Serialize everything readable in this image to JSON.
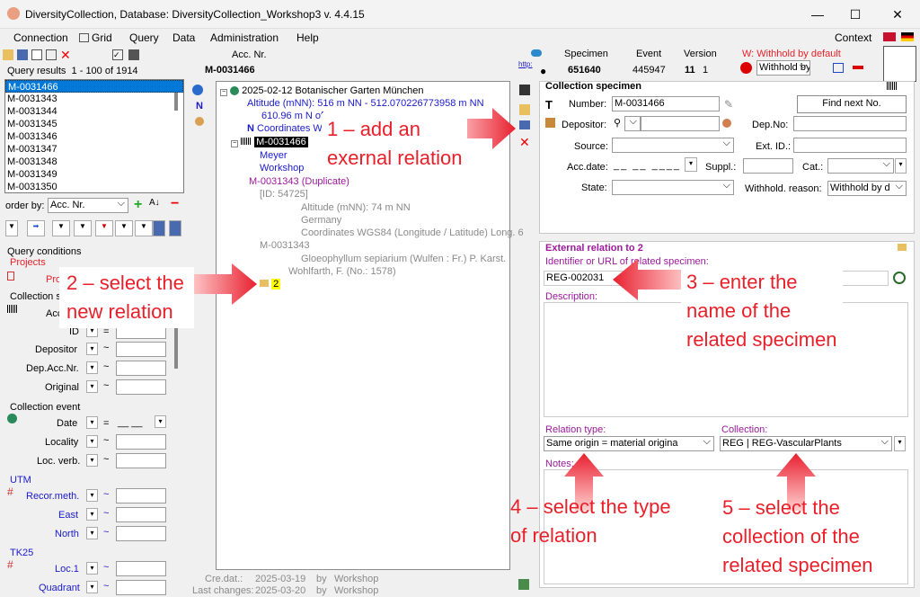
{
  "window": {
    "title": "DiversityCollection,  Database: DiversityCollection_Workshop3    v. 4.4.15"
  },
  "menu": {
    "connection": "Connection",
    "grid": "Grid",
    "query": "Query",
    "data": "Data",
    "administration": "Administration",
    "help": "Help",
    "context": "Context"
  },
  "query_results": {
    "label": "Query results",
    "range": "1 - 100 of 1914",
    "items": [
      "M-0031466",
      "M-0031343",
      "M-0031344",
      "M-0031345",
      "M-0031346",
      "M-0031347",
      "M-0031348",
      "M-0031349",
      "M-0031350"
    ]
  },
  "order_by": {
    "label": "order by:",
    "value": "Acc. Nr."
  },
  "query_conditions": {
    "label": "Query conditions",
    "projects": "Projects",
    "pro": "Pro",
    "collection_s": "Collection s",
    "acc": "Acc",
    "fields": [
      "ID",
      "Depositor",
      "Dep.Acc.Nr.",
      "Original"
    ],
    "collection_event": "Collection event",
    "event_fields": [
      "Date",
      "Locality",
      "Loc. verb."
    ],
    "utm": "UTM",
    "utm_fields": [
      "Recor.meth.",
      "East",
      "North"
    ],
    "tk25": "TK25",
    "tk25_fields": [
      "Loc.1",
      "Quadrant"
    ],
    "eq": "=",
    "tilde": "~",
    "date_blank": "__ __"
  },
  "header": {
    "acc_nr_label": "Acc. Nr.",
    "acc_nr": "M-0031466",
    "specimen_label": "Specimen",
    "specimen": "651640",
    "event_label": "Event",
    "event": "445947",
    "version_label": "Version",
    "version_a": "11",
    "version_b": "1",
    "withhold_label": "W: Withhold by default",
    "withhold_value": "Withhold by",
    "http": "http:"
  },
  "tree": {
    "event": "2025-02-12 Botanischer Garten München",
    "altitude": "Altitude (mNN): 516 m NN - 512.070226773958 m NN",
    "alt2": "610.96 m N of",
    "coords": "Coordinates W",
    "specimen": "M-0031466",
    "meyer": "Meyer",
    "workshop": "Workshop",
    "dup": "M-0031343 (Duplicate)",
    "id": "[ID: 54725]",
    "dup_alt": "Altitude (mNN): 74 m NN",
    "dup_country": "Germany",
    "dup_coords": "Coordinates WGS84 (Longitude / Latitude) Long. 6",
    "dup_spec": "M-0031343",
    "dup_taxon": "Gloeophyllum sepiarium (Wulfen : Fr.) P. Karst.",
    "wohlfarth": "Wohlfarth, F. (No.: 1578)",
    "new_rel": "2"
  },
  "footer": {
    "created_label": "Cre.dat.:",
    "created": "2025-03-19",
    "by": "by",
    "created_by": "Workshop",
    "changed_label": "Last changes:",
    "changed": "2025-03-20",
    "changed_by": "Workshop"
  },
  "collection_specimen": {
    "title": "Collection specimen",
    "number_label": "Number:",
    "number": "M-0031466",
    "find_next": "Find next No.",
    "depositor_label": "Depositor:",
    "depno_label": "Dep.No:",
    "source_label": "Source:",
    "extid_label": "Ext. ID.:",
    "accdate_label": "Acc.date:",
    "accdate_value": "__ __ ____",
    "suppl_label": "Suppl.:",
    "cat_label": "Cat.:",
    "state_label": "State:",
    "withhold_label": "Withhold. reason:",
    "withhold_value": "Withhold by d"
  },
  "external_relation": {
    "title": "External relation to 2",
    "identifier_label": "Identifier or URL of related specimen:",
    "identifier": "REG-002031",
    "description_label": "Description:",
    "relation_type_label": "Relation type:",
    "relation_type": "Same origin          = material origina",
    "collection_label": "Collection:",
    "collection": "REG | REG-VascularPlants",
    "notes_label": "Notes:"
  },
  "annotations": {
    "a1": [
      "1 – add an",
      "exernal  relation"
    ],
    "a2": [
      "2 – select the",
      "new relation"
    ],
    "a3": [
      "3 – enter the",
      "name of the",
      "related specimen"
    ],
    "a4": [
      "4 – select the type",
      "of relation"
    ],
    "a5": [
      "5 – select the",
      "collection of the",
      "related specimen"
    ]
  },
  "colors": {
    "annotation": "#e8202a",
    "selection": "#0078d7",
    "tree_blue": "#1a1acc",
    "tree_purple": "#9a1a9a"
  }
}
